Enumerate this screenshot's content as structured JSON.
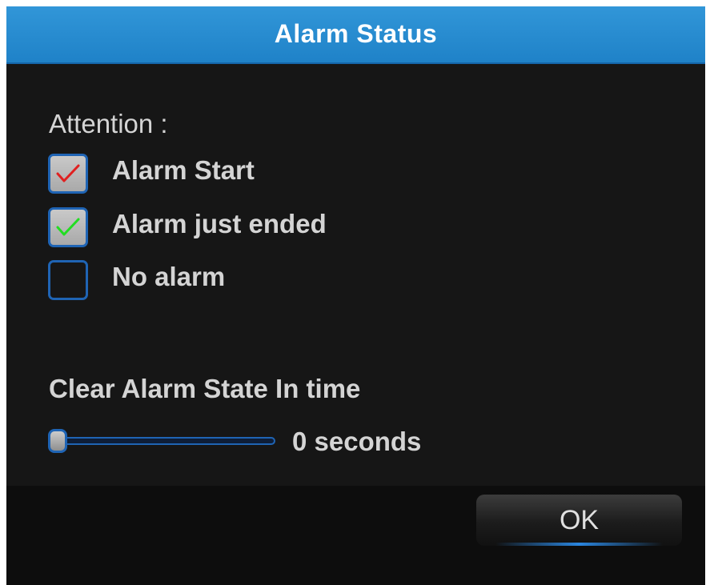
{
  "dialog": {
    "title": "Alarm Status",
    "attention_label": "Attention :",
    "legend": [
      {
        "label": "Alarm Start",
        "checked": true,
        "check_color": "#e02020"
      },
      {
        "label": "Alarm just ended",
        "checked": true,
        "check_color": "#22dd22"
      },
      {
        "label": "No alarm",
        "checked": false
      }
    ],
    "clear_label": "Clear Alarm State In time",
    "slider": {
      "value": 0,
      "value_text": "0 seconds"
    },
    "ok_label": "OK"
  },
  "colors": {
    "title_bar": "#2a8fd4",
    "background": "#161616",
    "accent_border": "#1f64b4",
    "text": "#d4d4d4"
  }
}
